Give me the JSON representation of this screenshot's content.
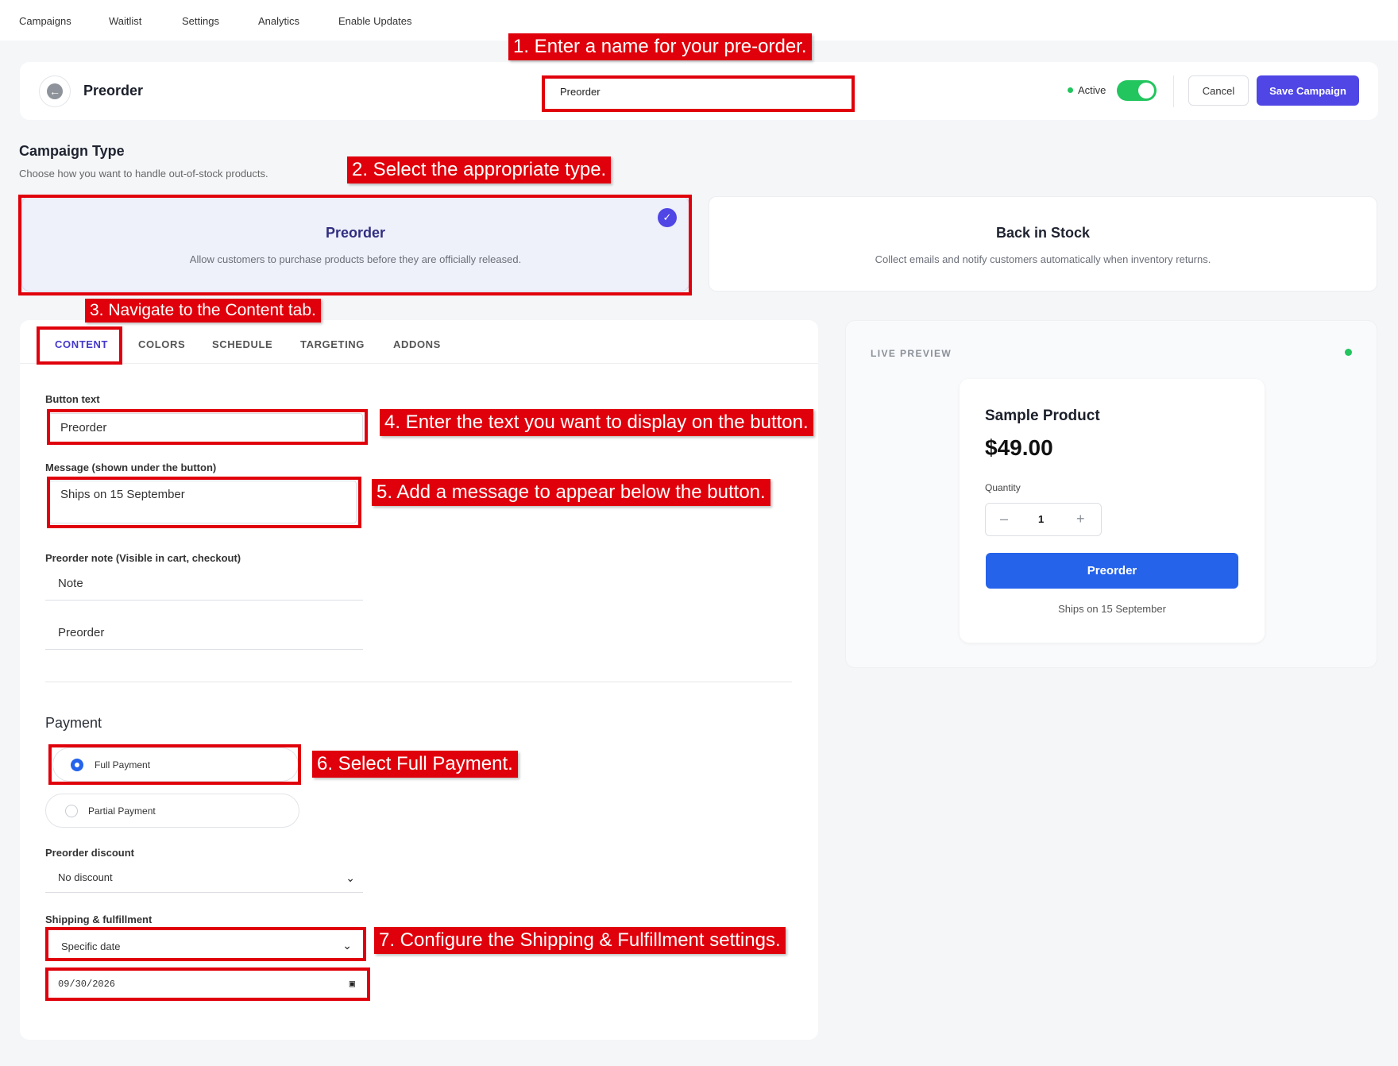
{
  "nav": [
    "Campaigns",
    "Waitlist",
    "Settings",
    "Analytics",
    "Enable Updates"
  ],
  "header": {
    "title": "Preorder",
    "name_value": "Preorder",
    "active_label": "Active",
    "cancel_label": "Cancel",
    "save_label": "Save Campaign"
  },
  "campaign_type": {
    "title": "Campaign Type",
    "subtitle": "Choose how you want to handle out-of-stock products.",
    "options": [
      {
        "title": "Preorder",
        "desc": "Allow customers to purchase products before they are officially released.",
        "selected": true
      },
      {
        "title": "Back in Stock",
        "desc": "Collect emails and notify customers automatically when inventory returns.",
        "selected": false
      }
    ]
  },
  "tabs": [
    "CONTENT",
    "COLORS",
    "SCHEDULE",
    "TARGETING",
    "ADDONS"
  ],
  "content": {
    "button_text_label": "Button text",
    "button_text_value": "Preorder",
    "message_label": "Message (shown under the button)",
    "message_value": "Ships on 15 September",
    "note_label": "Preorder note (Visible in cart, checkout)",
    "note_value": "Note",
    "note_value2": "Preorder"
  },
  "payment": {
    "title": "Payment",
    "full_label": "Full Payment",
    "partial_label": "Partial Payment",
    "discount_label": "Preorder discount",
    "discount_value": "No discount",
    "shipping_label": "Shipping & fulfillment",
    "shipping_value": "Specific date",
    "date_value": "09/30/2026"
  },
  "preview": {
    "label": "LIVE PREVIEW",
    "product_name": "Sample Product",
    "price": "$49.00",
    "quantity_label": "Quantity",
    "quantity": "1",
    "button": "Preorder",
    "message": "Ships on 15 September"
  },
  "annotations": [
    "1. Enter a name for your pre-order.",
    "2. Select the appropriate type.",
    "3. Navigate to the Content tab.",
    "4. Enter the text you want to display on the button.",
    "5. Add a message to appear below the button.",
    "6. Select Full Payment.",
    "7. Configure the Shipping & Fulfillment settings."
  ],
  "colors": {
    "accent": "#4f46e5",
    "toggle": "#22c55e",
    "preview_button": "#2563eb",
    "annotation": "#e0000b"
  }
}
